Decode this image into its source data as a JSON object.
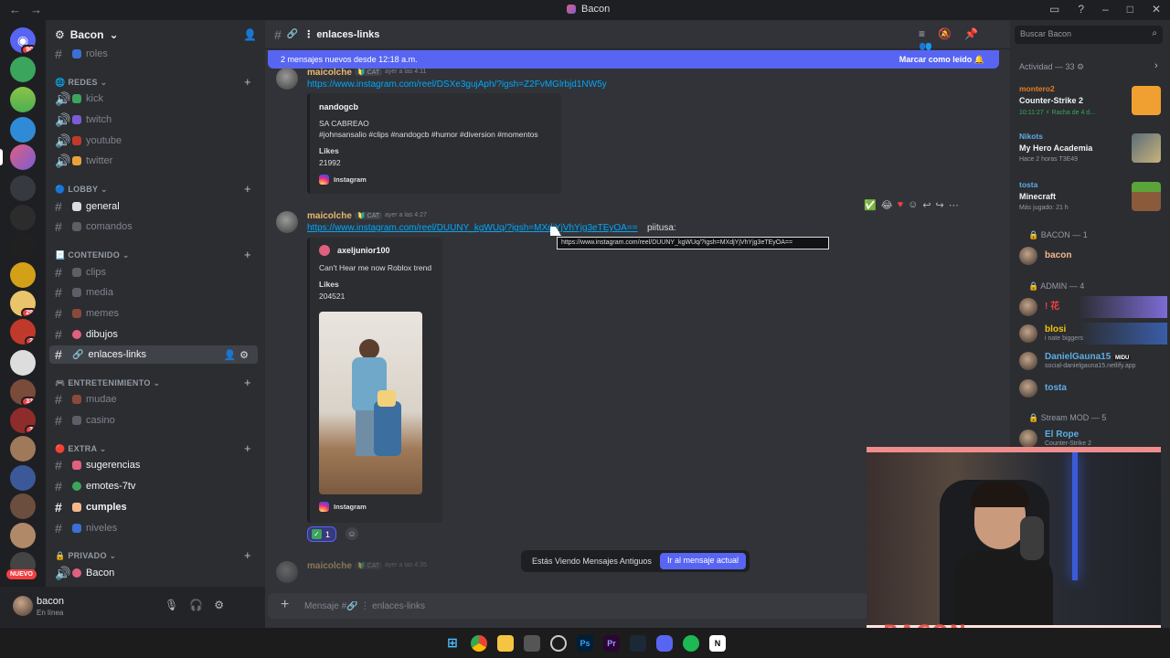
{
  "window": {
    "title": "Bacon"
  },
  "server": {
    "name": "Bacon"
  },
  "rail": {
    "badges": [
      "90",
      "2",
      "29",
      "2",
      "33",
      "3"
    ],
    "new_label": "NUEVO"
  },
  "sidebar": {
    "top_channel": "roles",
    "categories": [
      {
        "name": "REDES",
        "channels": [
          "kick",
          "twitch",
          "youtube",
          "twitter"
        ]
      },
      {
        "name": "LOBBY",
        "channels": [
          "general",
          "comandos"
        ]
      },
      {
        "name": "CONTENIDO",
        "channels": [
          "clips",
          "media",
          "memes",
          "dibujos",
          "enlaces-links"
        ]
      },
      {
        "name": "ENTRETENIMIENTO",
        "channels": [
          "mudae",
          "casino"
        ]
      },
      {
        "name": "EXTRA",
        "channels": [
          "sugerencias",
          "emotes-7tv",
          "cumples",
          "niveles"
        ]
      },
      {
        "name": "PRIVADO",
        "channels": [
          "Bacon"
        ]
      }
    ]
  },
  "user": {
    "name": "bacon",
    "status": "En línea"
  },
  "chat": {
    "channel": "enlaces-links",
    "new_messages_text": "2 mensajes nuevos desde 12:18 a.m.",
    "mark_read": "Marcar como leído",
    "messages": [
      {
        "author": "maicolche",
        "tag": "CAT",
        "time": "ayer a las 4:11",
        "link": "https://www.instagram.com/reel/DSXe3gujAph/?igsh=Z2FvMGlrbjd1NW5y",
        "embed": {
          "author": "nandogcb",
          "line1": "SA CABREAO",
          "line2": "#johnsansalio #clips #nandogcb #humor #diversion #momentos",
          "likes_label": "Likes",
          "likes": "21992",
          "footer": "Instagram"
        }
      },
      {
        "author": "maicolche",
        "tag": "CAT",
        "time": "ayer a las 4:27",
        "link": "https://www.instagram.com/reel/DUUNY_kgWUq/?igsh=MXdjYjVhYjg3eTEyOA==",
        "link_suffix": "piitusa:",
        "embed": {
          "author": "axeljunior100",
          "line1": "Can't Hear me now Roblox trend",
          "likes_label": "Likes",
          "likes": "204521",
          "footer": "Instagram"
        },
        "reaction_count": "1"
      },
      {
        "author": "maicolche",
        "tag": "CAT",
        "time": "ayer a las 4:35"
      }
    ],
    "tooltip": "https://www.instagram.com/reel/DUUNY_kgWUq/?igsh=MXdjYjVhYjg3eTEyOA==",
    "old_messages_text": "Estás Viendo Mensajes Antiguos",
    "jump_button": "Ir al mensaje actual",
    "composer_placeholder": "Mensaje #🔗 ⋮ enlaces-links"
  },
  "members": {
    "search_placeholder": "Buscar Bacon",
    "activity_header": "Actividad — 33",
    "activities": [
      {
        "user": "montero2",
        "game": "Counter-Strike 2",
        "detail": "10:11:27  ⚡ Racha de 4 d...",
        "color": "#e67e22"
      },
      {
        "user": "Nikots",
        "game": "My Hero Academia",
        "detail": "Hace 2 horas  T3E49",
        "color": "#5dade2"
      },
      {
        "user": "tosta",
        "game": "Minecraft",
        "detail": "Más jugado: 21 h",
        "color": "#5dade2"
      }
    ],
    "groups": [
      {
        "name": "BACON — 1",
        "members": [
          {
            "name": "bacon",
            "sub": "",
            "color": "#f5b88a"
          }
        ]
      },
      {
        "name": "ADMIN — 4",
        "members": [
          {
            "name": "! 花",
            "sub": "",
            "color": "#ed4245"
          },
          {
            "name": "blosi",
            "sub": "i nate biggers",
            "color": "#f1c40f"
          },
          {
            "name": "DanielGauna15",
            "sub": "social-danielgauna15.netlify.app",
            "color": "#5dade2",
            "badge": "MIDU"
          },
          {
            "name": "tosta",
            "sub": "",
            "color": "#5dade2"
          }
        ]
      },
      {
        "name": "Stream MOD — 5",
        "members": [
          {
            "name": "El Rope",
            "sub": "Counter-Strike 2",
            "color": "#5dade2"
          }
        ]
      }
    ]
  },
  "webcam": {
    "banner": "BACON"
  },
  "colors": {
    "accent": "#5865f2",
    "link": "#00a8fc",
    "author": "#e9b96e"
  }
}
